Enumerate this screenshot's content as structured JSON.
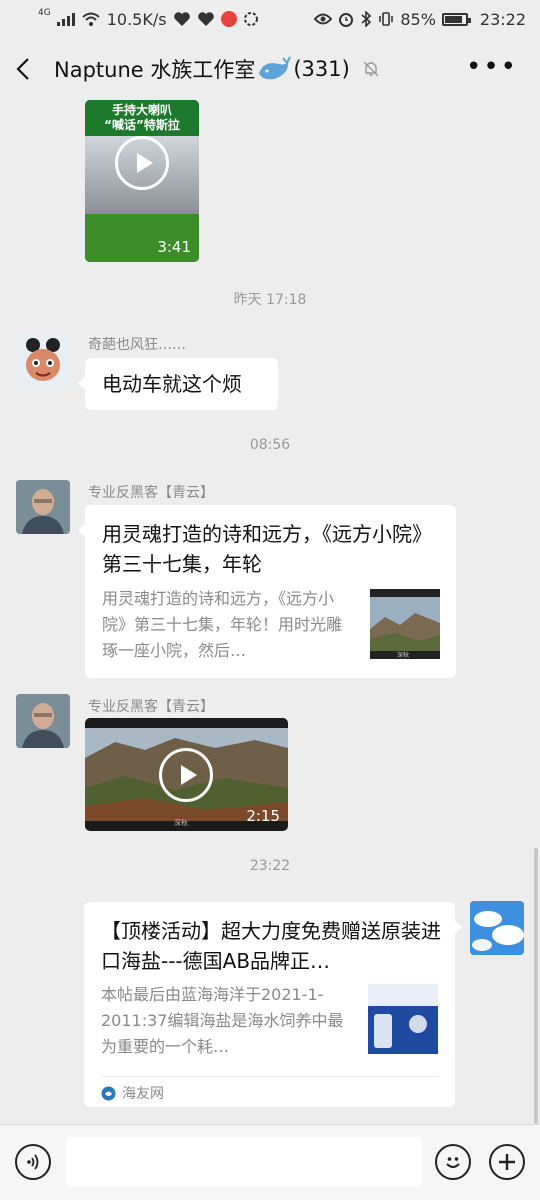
{
  "status": {
    "network": "4G",
    "speed": "10.5K/s",
    "battery": "85%",
    "time": "23:22",
    "battery_level": 0.85
  },
  "header": {
    "title": "Naptune 水族工作室",
    "count": "(331)"
  },
  "messages": {
    "video1": {
      "banner_line1": "手持大喇叭",
      "banner_line2": "“喊话”特斯拉",
      "duration": "3:41"
    },
    "ts1": "昨天 17:18",
    "m1": {
      "sender": "奇葩也风狂……",
      "text": "电动车就这个烦"
    },
    "ts2": "08:56",
    "m2": {
      "sender": "专业反黑客【青云】",
      "title": "用灵魂打造的诗和远方，《远方小院》第三十七集，年轮",
      "desc": "用灵魂打造的诗和远方，《远方小院》第三十七集，年轮！用时光雕琢一座小院，然后…",
      "thumb_caption": "深秋"
    },
    "m3": {
      "sender": "专业反黑客【青云】",
      "duration": "2:15",
      "caption": "深秋"
    },
    "ts3": "23:22",
    "m4": {
      "title": "【顶楼活动】超大力度免费赠送原装进口海盐---德国AB品牌正…",
      "desc": "本帖最后由蓝海海洋于2021-1-2011:37编辑海盐是海水饲养中最为重要的一个耗…",
      "source": "海友网"
    }
  },
  "icons": {
    "back": "chevron-left-icon",
    "mute": "bell-off-icon",
    "more": "more-icon",
    "voice": "voice-icon",
    "emoji": "emoji-icon",
    "plus": "plus-icon",
    "play": "play-icon"
  },
  "colors": {
    "background": "#ededed",
    "bubble": "#ffffff",
    "timestamp": "#9a9a9a",
    "accent_red": "#e64340"
  }
}
